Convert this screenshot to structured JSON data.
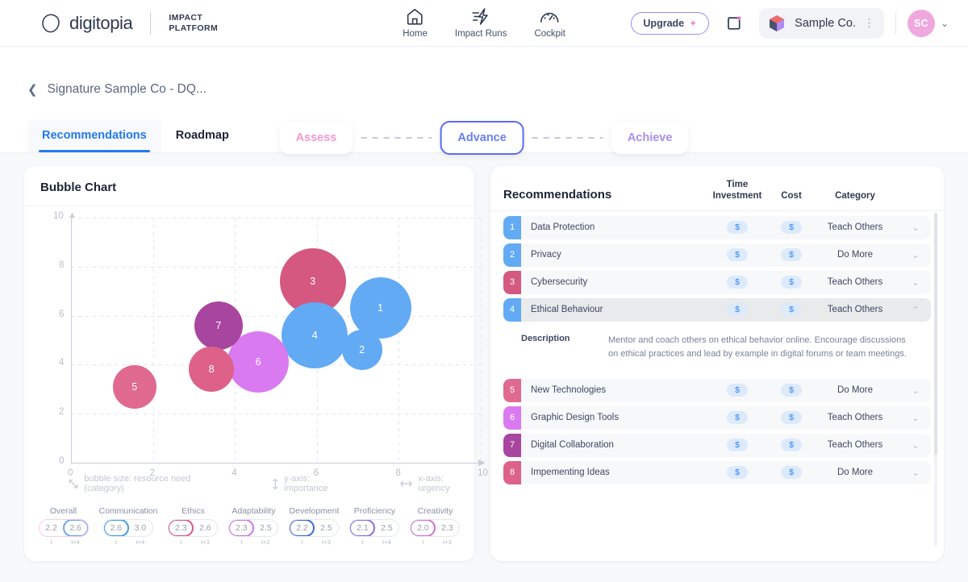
{
  "topbar": {
    "brand_word": "digitopia",
    "brand_sub_line1": "IMPACT",
    "brand_sub_line2": "PLATFORM",
    "nav": [
      {
        "label": "Home",
        "icon": "home-icon"
      },
      {
        "label": "Impact Runs",
        "icon": "lightning-icon"
      },
      {
        "label": "Cockpit",
        "icon": "gauge-icon"
      }
    ],
    "upgrade_label": "Upgrade",
    "org_name": "Sample Co.",
    "avatar_initials": "SC"
  },
  "subheader": {
    "breadcrumb": "Signature Sample Co - DQ...",
    "steps": [
      {
        "label": "Assess",
        "state": "assess"
      },
      {
        "label": "Advance",
        "state": "advance"
      },
      {
        "label": "Achieve",
        "state": "achieve"
      }
    ],
    "tabs": [
      {
        "label": "Recommendations",
        "active": true
      },
      {
        "label": "Roadmap",
        "active": false
      }
    ]
  },
  "chart_panel": {
    "title": "Bubble Chart",
    "legend": [
      {
        "icon": "resize-arrow-icon",
        "text": "bubble size: resource need (category)"
      },
      {
        "icon": "updown-arrow-icon",
        "text": "y-axis: importance"
      },
      {
        "icon": "leftright-arrow-icon",
        "text": "x-axis: urgency"
      }
    ],
    "scores": [
      {
        "name": "Overall",
        "v1": "2.2",
        "v2": "2.6",
        "t1": "t",
        "t2": "t+4",
        "hl": "right",
        "color": "#6aa6f2",
        "left_color": "#f6cce6"
      },
      {
        "name": "Communication",
        "v1": "2.6",
        "v2": "3.0",
        "t1": "t",
        "t2": "t+4",
        "hl": "left",
        "color": "#3f9bf0",
        "left_color": "#3f9bf0"
      },
      {
        "name": "Ethics",
        "v1": "2.3",
        "v2": "2.6",
        "t1": "t",
        "t2": "t+3",
        "hl": "left",
        "color": "#e0577e",
        "left_color": "#e0577e"
      },
      {
        "name": "Adaptability",
        "v1": "2.3",
        "v2": "2.5",
        "t1": "t",
        "t2": "t+2",
        "hl": "left",
        "color": "#d173ee",
        "left_color": "#d173ee"
      },
      {
        "name": "Development",
        "v1": "2.2",
        "v2": "2.5",
        "t1": "t",
        "t2": "t+3",
        "hl": "left",
        "color": "#3a6ce0",
        "left_color": "#3a6ce0"
      },
      {
        "name": "Proficiency",
        "v1": "2.1",
        "v2": "2.5",
        "t1": "t",
        "t2": "t+4",
        "hl": "left",
        "color": "#8b6cf0",
        "left_color": "#8b6cf0"
      },
      {
        "name": "Creativity",
        "v1": "2.0",
        "v2": "2.3",
        "t1": "t",
        "t2": "t+3",
        "hl": "left",
        "color": "#d46fd0",
        "left_color": "#d46fd0"
      }
    ]
  },
  "chart_data": {
    "type": "scatter",
    "title": "Bubble Chart",
    "xlabel": "x-axis: urgency",
    "ylabel": "y-axis: importance",
    "size_label": "bubble size: resource need (category)",
    "xlim": [
      0,
      10
    ],
    "ylim": [
      0,
      10
    ],
    "xticks": [
      0,
      2,
      4,
      6,
      8,
      10
    ],
    "yticks": [
      0,
      2,
      4,
      6,
      8,
      10
    ],
    "grid": true,
    "legend_position": "below-axis",
    "points": [
      {
        "label": "1",
        "name": "Data Protection",
        "x": 7.55,
        "y": 6.3,
        "r": 38,
        "color": "#63aaf5"
      },
      {
        "label": "2",
        "name": "Privacy",
        "x": 7.1,
        "y": 4.6,
        "r": 25,
        "color": "#63aaf5"
      },
      {
        "label": "3",
        "name": "Cybersecurity",
        "x": 5.9,
        "y": 7.4,
        "r": 41,
        "color": "#d4587f"
      },
      {
        "label": "4",
        "name": "Ethical Behaviour",
        "x": 5.95,
        "y": 5.2,
        "r": 41,
        "color": "#63aaf5"
      },
      {
        "label": "5",
        "name": "New Technologies",
        "x": 1.55,
        "y": 3.1,
        "r": 27,
        "color": "#e0698f"
      },
      {
        "label": "6",
        "name": "Graphic Design Tools",
        "x": 4.57,
        "y": 4.1,
        "r": 38,
        "color": "#d97af0"
      },
      {
        "label": "7",
        "name": "Digital Collaboration",
        "x": 3.6,
        "y": 5.6,
        "r": 30,
        "color": "#a8459e"
      },
      {
        "label": "8",
        "name": "Impementing Ideas",
        "x": 3.43,
        "y": 3.8,
        "r": 28,
        "color": "#de6189"
      }
    ]
  },
  "recommendations_panel": {
    "title": "Recommendations",
    "columns": {
      "time_investment_line1": "Time",
      "time_investment_line2": "Investment",
      "cost": "Cost",
      "category": "Category"
    },
    "rows": [
      {
        "num": "1",
        "name": "Data Protection",
        "time": "$",
        "cost": "$",
        "category": "Teach Others",
        "color": "#63aaf5",
        "expanded": false
      },
      {
        "num": "2",
        "name": "Privacy",
        "time": "$",
        "cost": "$",
        "category": "Do More",
        "color": "#63aaf5",
        "expanded": false
      },
      {
        "num": "3",
        "name": "Cybersecurity",
        "time": "$",
        "cost": "$",
        "category": "Teach Others",
        "color": "#d4587f",
        "expanded": false
      },
      {
        "num": "4",
        "name": "Ethical Behaviour",
        "time": "$",
        "cost": "$",
        "category": "Teach Others",
        "color": "#63aaf5",
        "expanded": true
      },
      {
        "num": "5",
        "name": "New Technologies",
        "time": "$",
        "cost": "$",
        "category": "Do More",
        "color": "#e0698f",
        "expanded": false
      },
      {
        "num": "6",
        "name": "Graphic Design Tools",
        "time": "$",
        "cost": "$",
        "category": "Teach Others",
        "color": "#d97af0",
        "expanded": false
      },
      {
        "num": "7",
        "name": "Digital Collaboration",
        "time": "$",
        "cost": "$",
        "category": "Teach Others",
        "color": "#a8459e",
        "expanded": false
      },
      {
        "num": "8",
        "name": "Impementing Ideas",
        "time": "$",
        "cost": "$",
        "category": "Do More",
        "color": "#de6189",
        "expanded": false
      }
    ],
    "description_label": "Description",
    "description_text": "Mentor and coach others on ethical behavior online. Encourage discussions on ethical practices and lead by example in digital forums or team meetings."
  }
}
